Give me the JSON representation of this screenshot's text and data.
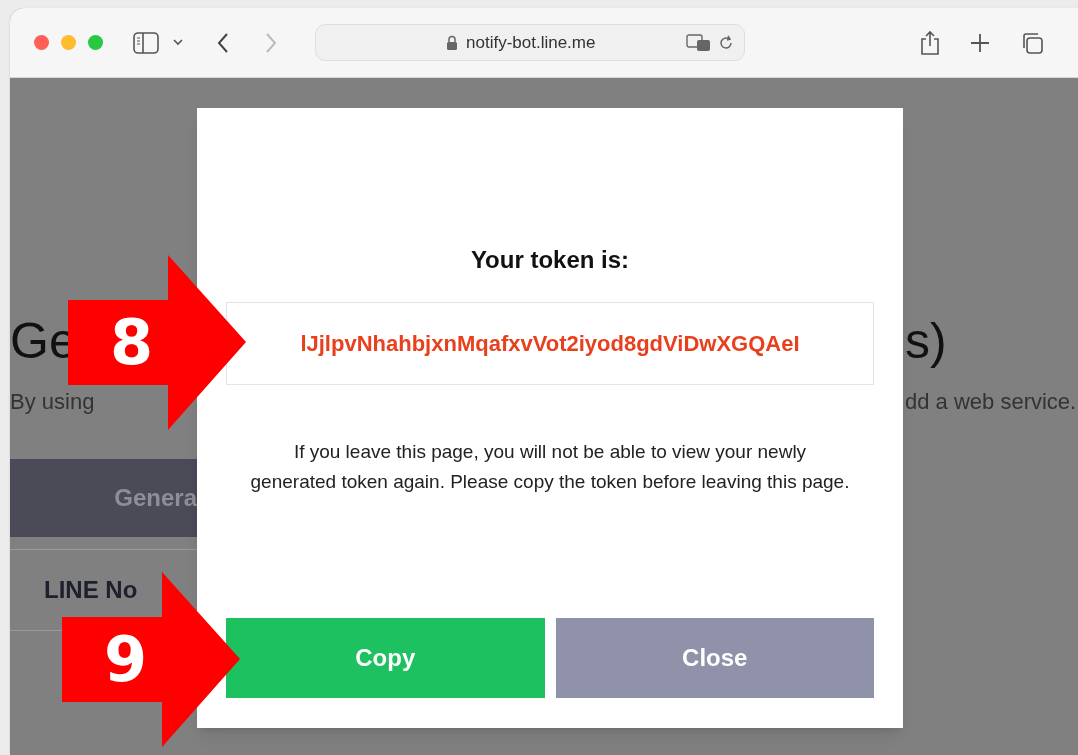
{
  "browser": {
    "address": "notify-bot.line.me",
    "back_enabled": true,
    "forward_enabled": false
  },
  "page": {
    "heading_left": "Ge",
    "heading_right": "s)",
    "intro_left": "By using",
    "intro_right": "dd a web service.",
    "bar_text": "Genera",
    "row_text": "LINE No"
  },
  "dialog": {
    "title": "Your token is:",
    "token": "lJjlpvNhahbjxnMqafxvVot2iyod8gdViDwXGQAeI",
    "message": "If you leave this page, you will not be able to view your newly generated token again. Please copy the token before leaving this page.",
    "buttons": [
      {
        "label": "Copy",
        "kind": "primary"
      },
      {
        "label": "Close",
        "kind": "secondary"
      }
    ]
  },
  "annotations": [
    {
      "label": "8"
    },
    {
      "label": "9"
    }
  ]
}
